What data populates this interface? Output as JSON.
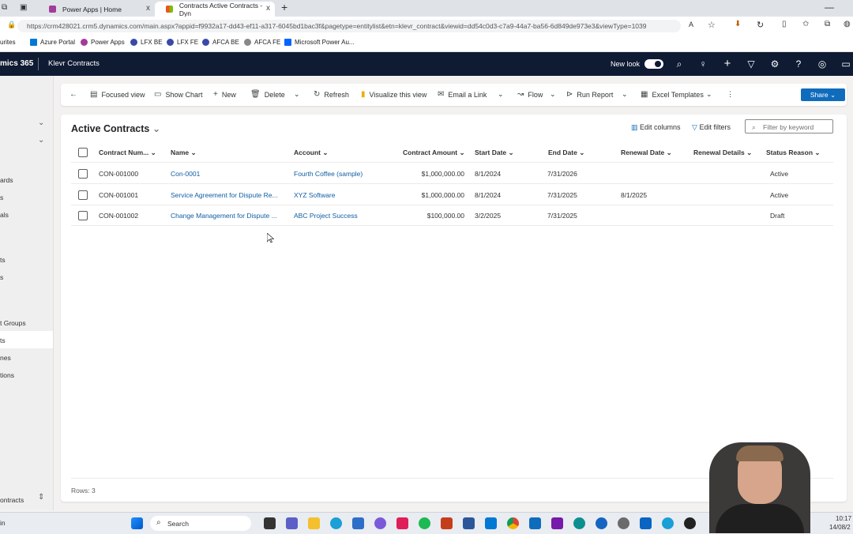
{
  "browser": {
    "tabs": [
      {
        "label": "Power Apps | Home",
        "close": "x"
      },
      {
        "label": "Contracts Active Contracts - Dyn",
        "close": "x"
      }
    ],
    "new_tab": "+",
    "url": "https://crm428021.crm5.dynamics.com/main.aspx?appid=f9932a17-dd43-ef11-a317-6045bd1bac3f&pagetype=entitylist&etn=klevr_contract&viewid=dd54c0d3-c7a9-44a7-ba56-6d849de973e3&viewType=1039",
    "bookmarks": [
      "urites",
      "Azure Portal",
      "Power Apps",
      "LFX BE",
      "LFX FE",
      "AFCA BE",
      "AFCA FE",
      "Microsoft Power Au..."
    ]
  },
  "header": {
    "brand": "mics 365",
    "app_name": "Klevr Contracts",
    "new_look_label": "New look"
  },
  "sidebar": {
    "items": [
      "ards",
      "s",
      "als",
      "ts",
      "s",
      "t Groups",
      "ts",
      "nes",
      "tions"
    ],
    "footer_label": "ontracts"
  },
  "commands": {
    "focused_view": "Focused view",
    "show_chart": "Show Chart",
    "new": "New",
    "delete": "Delete",
    "refresh": "Refresh",
    "visualize": "Visualize this view",
    "email_link": "Email a Link",
    "flow": "Flow",
    "run_report": "Run Report",
    "excel_templates": "Excel Templates",
    "share": "Share"
  },
  "view": {
    "title": "Active Contracts",
    "edit_columns": "Edit columns",
    "edit_filters": "Edit filters",
    "filter_placeholder": "Filter by keyword",
    "columns": [
      "Contract Num...",
      "Name",
      "Account",
      "Contract Amount",
      "Start Date",
      "End Date",
      "Renewal Date",
      "Renewal Details",
      "Status Reason"
    ],
    "rows": [
      {
        "number": "CON-001000",
        "name": "Con-0001",
        "account": "Fourth Coffee (sample)",
        "amount": "$1,000,000.00",
        "start": "8/1/2024",
        "end": "7/31/2026",
        "renewal_date": "",
        "renewal_details": "",
        "status": "Active"
      },
      {
        "number": "CON-001001",
        "name": "Service Agreement for Dispute Re...",
        "account": "XYZ Software",
        "amount": "$1,000,000.00",
        "start": "8/1/2024",
        "end": "7/31/2025",
        "renewal_date": "8/1/2025",
        "renewal_details": "",
        "status": "Active"
      },
      {
        "number": "CON-001002",
        "name": "Change Management for Dispute ...",
        "account": "ABC Project Success",
        "amount": "$100,000.00",
        "start": "3/2/2025",
        "end": "7/31/2025",
        "renewal_date": "",
        "renewal_details": "",
        "status": "Draft"
      }
    ],
    "row_count": "Rows: 3"
  },
  "taskbar": {
    "search_label": "Search",
    "time": "10:17",
    "date": "14/08/2",
    "left_label": "in"
  },
  "colors": {
    "header_bg": "#0f1b33",
    "accent": "#0f6cbd",
    "link": "#115ea3"
  }
}
